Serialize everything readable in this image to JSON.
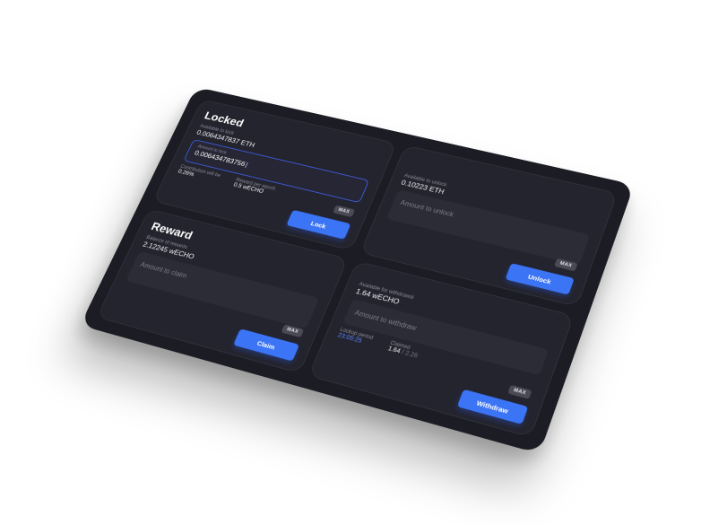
{
  "locked": {
    "title": "Locked",
    "available_label": "Available to lock",
    "available_value": "0.0064347837 ETH",
    "amount_label": "Amount to lock",
    "amount_value": "0.006434783756",
    "contribution_label": "Contribution will be",
    "contribution_value": "0.26%",
    "reward_label": "Reward per epoch",
    "reward_value": "0.5 wECHO",
    "max_label": "MAX",
    "button_label": "Lock"
  },
  "unlock": {
    "available_label": "Available to unlock",
    "available_value": "0.10223 ETH",
    "amount_placeholder": "Amount to unlock",
    "max_label": "MAX",
    "button_label": "Unlock"
  },
  "reward": {
    "title": "Reward",
    "balance_label": "Balance of rewards",
    "balance_value": "2.12245 wECHO",
    "amount_placeholder": "Amount to claim",
    "max_label": "MAX",
    "button_label": "Claim"
  },
  "withdraw": {
    "available_label": "Available for withdrawal",
    "available_value": "1.64 wECHO",
    "amount_placeholder": "Amount to withdraw",
    "lockup_label": "Lockup period",
    "lockup_value": "23:05:25",
    "claimed_label": "Claimed",
    "claimed_value": "1.64",
    "claimed_total": "/ 2.26",
    "max_label": "MAX",
    "button_label": "Withdraw"
  },
  "colors": {
    "accent": "#3b74f4",
    "panel": "#1c1c25",
    "card": "#24242e"
  }
}
